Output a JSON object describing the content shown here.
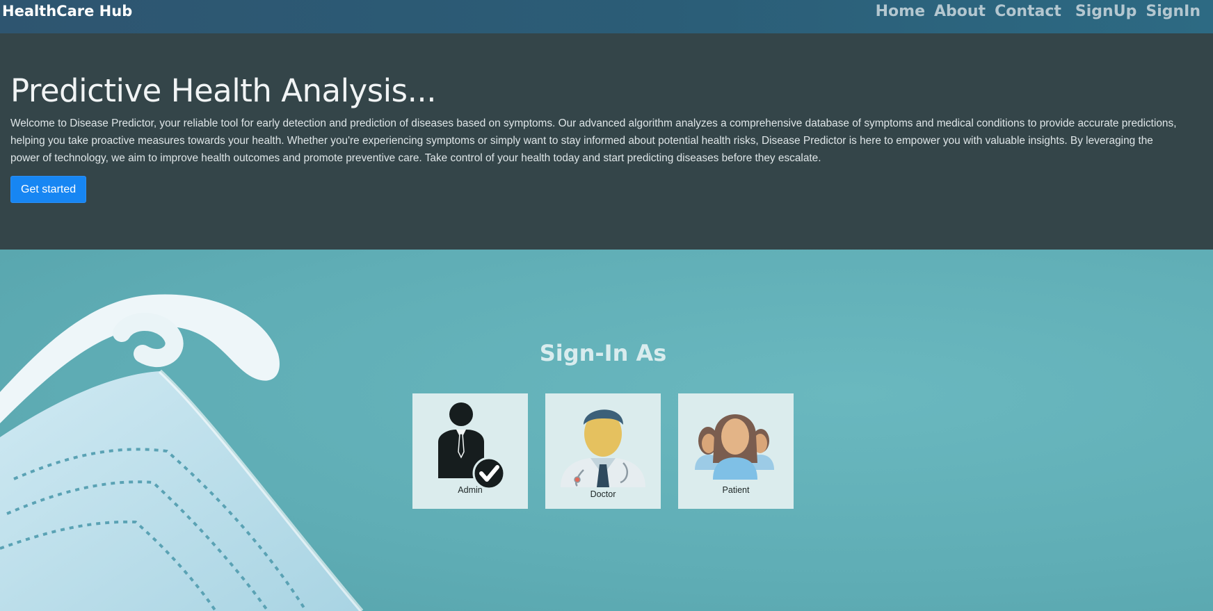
{
  "navbar": {
    "brand": "HealthCare Hub",
    "links": [
      {
        "label": "Home"
      },
      {
        "label": "About"
      },
      {
        "label": "Contact"
      },
      {
        "label": "SignUp"
      },
      {
        "label": "SignIn"
      }
    ]
  },
  "jumbotron": {
    "title": "Predictive Health Analysis...",
    "description": "Welcome to Disease Predictor, your reliable tool for early detection and prediction of diseases based on symptoms. Our advanced algorithm analyzes a comprehensive database of symptoms and medical conditions to provide accurate predictions, helping you take proactive measures towards your health. Whether you're experiencing symptoms or simply want to stay informed about potential health risks, Disease Predictor is here to empower you with valuable insights. By leveraging the power of technology, we aim to improve health outcomes and promote preventive care. Take control of your health today and start predicting diseases before they escalate.",
    "cta_label": "Get started"
  },
  "signin": {
    "heading": "Sign-In As",
    "roles": [
      {
        "label": "Admin",
        "icon": "admin-icon"
      },
      {
        "label": "Doctor",
        "icon": "doctor-icon"
      },
      {
        "label": "Patient",
        "icon": "patient-icon"
      }
    ]
  },
  "colors": {
    "navbar_bg": "#2b5d77",
    "jumbotron_bg": "#344549",
    "primary_button": "#1786f3",
    "section_bg": "#62aeb6"
  }
}
